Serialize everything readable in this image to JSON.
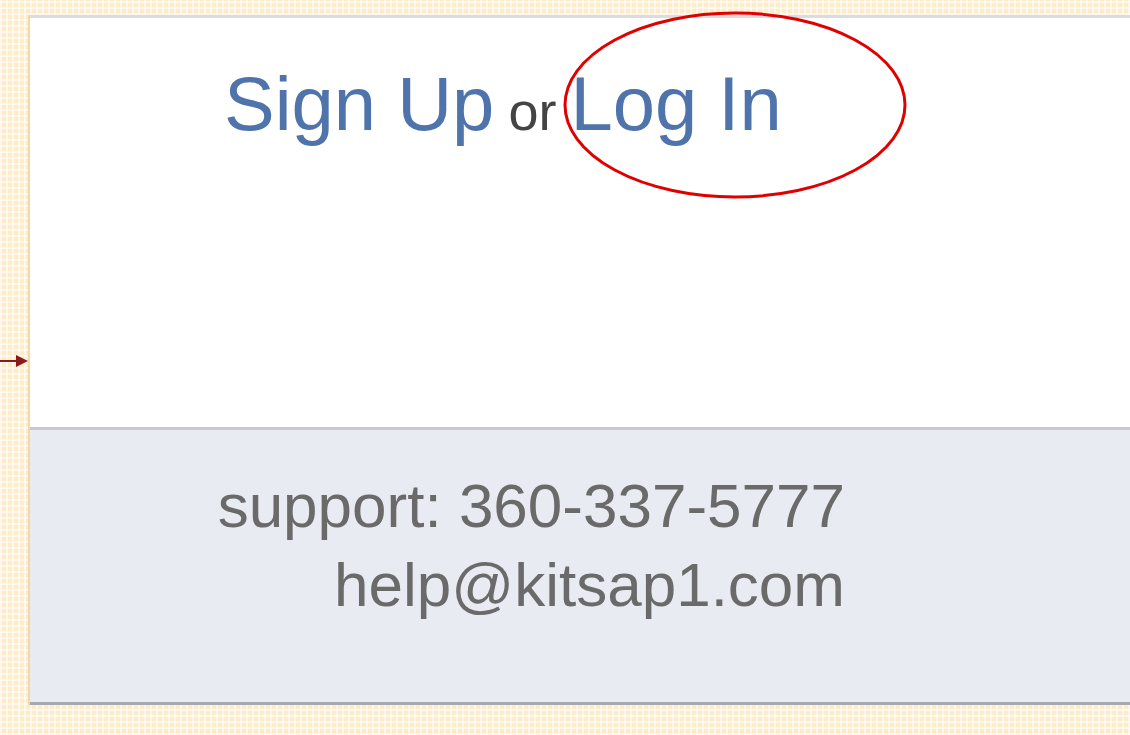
{
  "auth": {
    "links": [
      {
        "label": "Sign Up"
      },
      {
        "label": "Log In"
      }
    ],
    "separator": "or"
  },
  "footer": {
    "support": "support: 360-337-5777",
    "email": "help@kitsap1.com"
  }
}
